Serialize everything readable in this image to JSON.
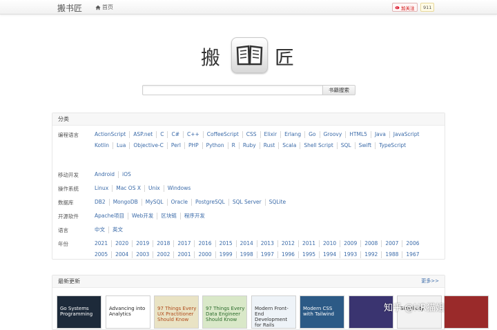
{
  "navbar": {
    "brand": "搬书匠",
    "home_label": "首页",
    "follow_label": "加关注",
    "follow_count": "911"
  },
  "logo": {
    "left": "搬",
    "right": "匠"
  },
  "search": {
    "value": "",
    "button_label": "书籍搜索"
  },
  "categories": {
    "title": "分类",
    "rows": [
      {
        "label": "编程语言",
        "items": [
          "ActionScript",
          "ASP.net",
          "C",
          "C#",
          "C++",
          "CoffeeScript",
          "CSS",
          "Elixir",
          "Erlang",
          "Go",
          "Groovy",
          "HTML5",
          "Java",
          "JavaScript",
          "Kotlin",
          "Lua",
          "Objective-C",
          "Perl",
          "PHP",
          "Python",
          "R",
          "Ruby",
          "Rust",
          "Scala",
          "Shell Script",
          "SQL",
          "Swift",
          "TypeScript"
        ]
      },
      {
        "label": "移动开发",
        "items": [
          "Android",
          "iOS"
        ]
      },
      {
        "label": "操作系统",
        "items": [
          "Linux",
          "Mac OS X",
          "Unix",
          "Windows"
        ]
      },
      {
        "label": "数据库",
        "items": [
          "DB2",
          "MongoDB",
          "MySQL",
          "Oracle",
          "PostgreSQL",
          "SQL Server",
          "SQLite"
        ]
      },
      {
        "label": "开源软件",
        "items": [
          "Apache项目",
          "Web开发",
          "区块链",
          "程序开发"
        ]
      },
      {
        "label": "语言",
        "items": [
          "中文",
          "英文"
        ]
      },
      {
        "label": "年份",
        "items": [
          "2021",
          "2020",
          "2019",
          "2018",
          "2017",
          "2016",
          "2015",
          "2014",
          "2013",
          "2012",
          "2011",
          "2010",
          "2009",
          "2008",
          "2007",
          "2006",
          "2005",
          "2004",
          "2003",
          "2002",
          "2001",
          "2000",
          "1999",
          "1998",
          "1997",
          "1996",
          "1995",
          "1994",
          "1993",
          "1992",
          "1988",
          "1967"
        ]
      }
    ]
  },
  "latest": {
    "title": "最新更新",
    "more_label": "更多>>",
    "books": [
      {
        "title": "Go Systems Programming",
        "bg": "#1d2a3a",
        "fg": "#ffffff"
      },
      {
        "title": "Advancing into Analytics",
        "bg": "#ffffff",
        "fg": "#222222"
      },
      {
        "title": "97 Things Every UX Practitioner Should Know",
        "bg": "#e9e3c4",
        "fg": "#b04a1a"
      },
      {
        "title": "97 Things Every Data Engineer Should Know",
        "bg": "#d9e8c8",
        "fg": "#2b6b2b"
      },
      {
        "title": "Modern Front-End Development for Rails",
        "bg": "#eef3f8",
        "fg": "#333333"
      },
      {
        "title": "Modern CSS with Tailwind",
        "bg": "#2c5a86",
        "fg": "#ffffff"
      },
      {
        "title": "",
        "bg": "#3a3470",
        "fg": "#ffffff"
      },
      {
        "title": "Simplicity",
        "bg": "#f2f2f2",
        "fg": "#111111"
      },
      {
        "title": "",
        "bg": "#9a2a2a",
        "fg": "#ffffff"
      }
    ]
  },
  "watermark": "知乎 @HR猫姐"
}
